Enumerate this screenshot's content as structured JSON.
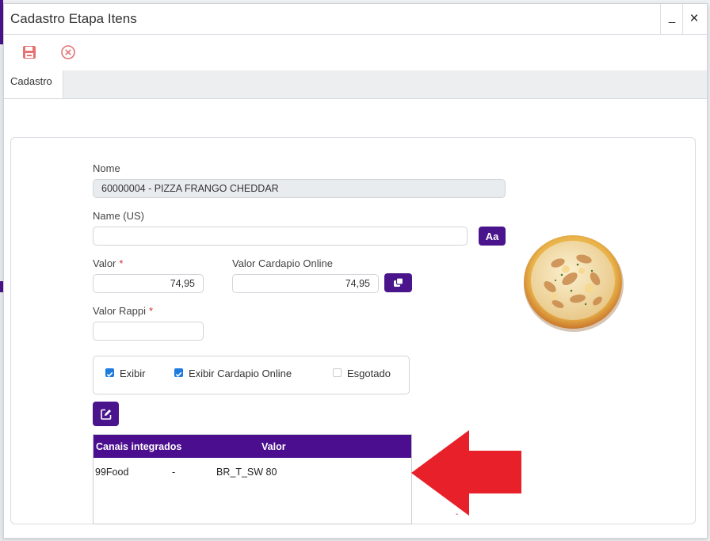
{
  "window": {
    "title": "Cadastro Etapa Itens",
    "minimize": "_",
    "close": "×"
  },
  "toolbar": {
    "save_icon": "floppy-disk-icon",
    "cancel_icon": "circle-x-icon"
  },
  "tabs": [
    {
      "label": "Cadastro"
    }
  ],
  "form": {
    "nome": {
      "label": "Nome",
      "value": "60000004 - PIZZA FRANGO CHEDDAR"
    },
    "name_us": {
      "label": "Name (US)",
      "value": "",
      "button": "Aa"
    },
    "valor": {
      "label": "Valor",
      "required": "*",
      "value": "74,95"
    },
    "valor_cardapio": {
      "label": "Valor Cardapio Online",
      "value": "74,95",
      "copy_icon": "copy-icon"
    },
    "valor_rappi": {
      "label": "Valor Rappi",
      "required": "*",
      "value": ""
    },
    "checkboxes": [
      {
        "label": "Exibir",
        "checked": true
      },
      {
        "label": "Exibir Cardapio Online",
        "checked": true
      },
      {
        "label": "Esgotado",
        "checked": false
      }
    ],
    "edit_icon": "edit-icon"
  },
  "grid": {
    "columns": [
      "Canais integrados",
      "Valor"
    ],
    "rows": [
      {
        "canal": "99Food",
        "sep": "-",
        "codigo": "BR_T_SW 80"
      }
    ]
  },
  "image": {
    "icon": "pizza-image"
  },
  "annotation": {
    "arrow_color": "#e8202a",
    "marker": "-"
  },
  "colors": {
    "accent": "#4a148c",
    "grid_header": "#4a0e8f",
    "checkbox": "#1e7be0",
    "save_icon": "#e57373"
  }
}
